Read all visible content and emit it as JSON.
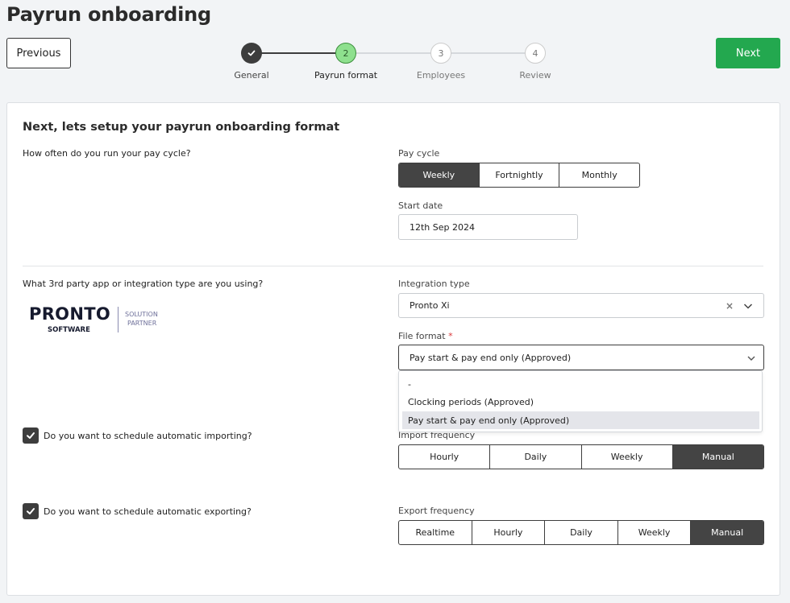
{
  "page": {
    "title": "Payrun onboarding"
  },
  "nav": {
    "previous_label": "Previous",
    "next_label": "Next"
  },
  "stepper": {
    "steps": [
      {
        "number": "1",
        "label": "General",
        "state": "done"
      },
      {
        "number": "2",
        "label": "Payrun format",
        "state": "active"
      },
      {
        "number": "3",
        "label": "Employees",
        "state": "todo"
      },
      {
        "number": "4",
        "label": "Review",
        "state": "todo"
      }
    ]
  },
  "form": {
    "heading": "Next, lets setup your payrun onboarding format",
    "pay_cycle": {
      "question": "How often do you run your pay cycle?",
      "label": "Pay cycle",
      "options": [
        "Weekly",
        "Fortnightly",
        "Monthly"
      ],
      "selected": "Weekly",
      "start_date_label": "Start date",
      "start_date_value": "12th Sep 2024"
    },
    "integration": {
      "question": "What 3rd party app or integration type are you using?",
      "logo": {
        "brand": "PRONTO",
        "sub": "SOFTWARE",
        "partner_line1": "SOLUTION",
        "partner_line2": "PARTNER"
      },
      "type_label": "Integration type",
      "type_value": "Pronto Xi",
      "file_format_label": "File format",
      "required_mark": "*",
      "file_format_value": "Pay start & pay end only (Approved)",
      "dropdown_options": [
        "-",
        "Clocking periods (Approved)",
        "Pay start & pay end only (Approved)"
      ],
      "dropdown_highlighted": "Pay start & pay end only (Approved)"
    },
    "import": {
      "question": "Do you want to schedule automatic importing?",
      "checked": true,
      "label": "Import frequency",
      "options": [
        "Hourly",
        "Daily",
        "Weekly",
        "Manual"
      ],
      "selected": "Manual"
    },
    "export": {
      "question": "Do you want to schedule automatic exporting?",
      "checked": true,
      "label": "Export frequency",
      "options": [
        "Realtime",
        "Hourly",
        "Daily",
        "Weekly",
        "Manual"
      ],
      "selected": "Manual"
    }
  },
  "colors": {
    "accent_green": "#23a84f",
    "dark": "#3d3d3d",
    "active_step": "#8ee08e"
  }
}
